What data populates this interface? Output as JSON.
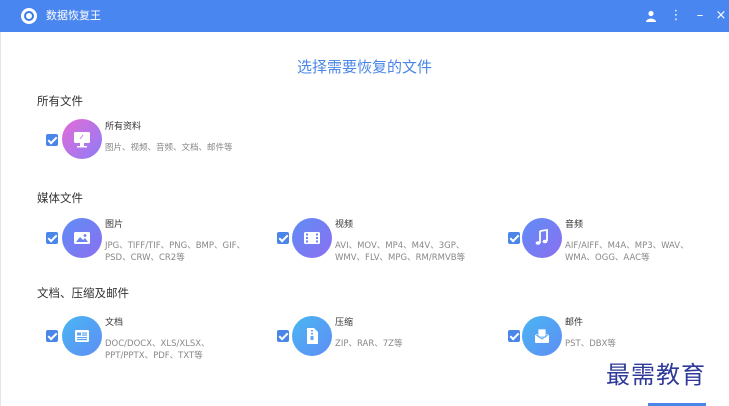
{
  "window": {
    "title": "数据恢复王",
    "buttons": {
      "user_icon": "user-icon",
      "menu_glyph": "⋮",
      "minimize_glyph": "–",
      "close_glyph": "×"
    }
  },
  "main": {
    "heading": "选择需要恢复的文件"
  },
  "sections": [
    {
      "title": "所有文件",
      "items": [
        {
          "title": "所有资料",
          "desc": "图片、视频、音频、文档、邮件等",
          "checked": true,
          "icon": "all-files-icon",
          "colors": [
            "#e46cd6",
            "#8d7cf7"
          ]
        }
      ]
    },
    {
      "title": "媒体文件",
      "items": [
        {
          "title": "图片",
          "desc": "JPG、TIFF/TIF、PNG、BMP、GIF、PSD、CRW、CR2等",
          "checked": true,
          "icon": "image-icon",
          "colors": [
            "#5f8df5",
            "#8b6ff0"
          ]
        },
        {
          "title": "视频",
          "desc": "AVI、MOV、MP4、M4V、3GP、WMV、FLV、MPG、RM/RMVB等",
          "checked": true,
          "icon": "video-icon",
          "colors": [
            "#5f8df5",
            "#8b6ff0"
          ]
        },
        {
          "title": "音频",
          "desc": "AIF/AIFF、M4A、MP3、WAV、WMA、OGG、AAC等",
          "checked": true,
          "icon": "audio-icon",
          "colors": [
            "#5f8df5",
            "#8b6ff0"
          ]
        }
      ]
    },
    {
      "title": "文档、压缩及邮件",
      "items": [
        {
          "title": "文档",
          "desc": "DOC/DOCX、XLS/XLSX、PPT/PPTX、PDF、TXT等",
          "checked": true,
          "icon": "document-icon",
          "colors": [
            "#49b6f2",
            "#5f8df5"
          ]
        },
        {
          "title": "压缩",
          "desc": "ZIP、RAR、7Z等",
          "checked": true,
          "icon": "archive-icon",
          "colors": [
            "#49b6f2",
            "#5f8df5"
          ]
        },
        {
          "title": "邮件",
          "desc": "PST、DBX等",
          "checked": true,
          "icon": "mail-icon",
          "colors": [
            "#49b6f2",
            "#5f8df5"
          ]
        }
      ]
    }
  ],
  "watermark": "最需教育",
  "theme": {
    "accent": "#4a86e8",
    "titlebar": "#4a86f0"
  }
}
